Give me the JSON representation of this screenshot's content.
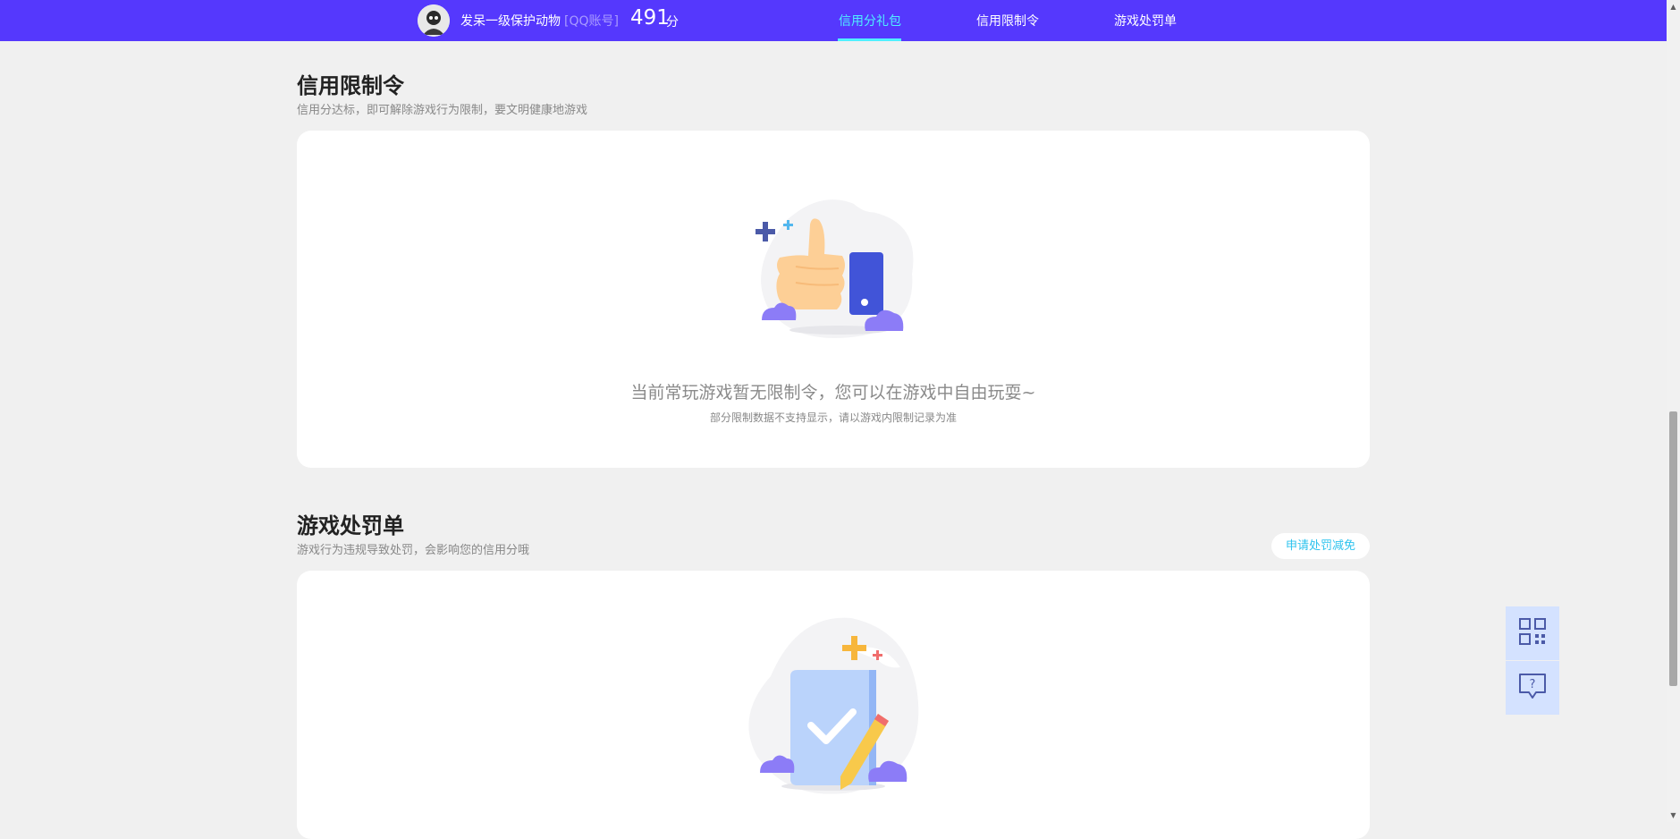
{
  "header": {
    "user_name": "发呆一级保护动物",
    "account_type": "[QQ账号]",
    "score": "491",
    "score_unit": "分",
    "tabs": [
      {
        "label": "信用分礼包",
        "active": true
      },
      {
        "label": "信用限制令",
        "active": false
      },
      {
        "label": "游戏处罚单",
        "active": false
      }
    ]
  },
  "restriction": {
    "title": "信用限制令",
    "subtitle": "信用分达标，即可解除游戏行为限制，要文明健康地游戏",
    "empty_text": "当前常玩游戏暂无限制令，您可以在游戏中自由玩耍~",
    "note": "部分限制数据不支持显示，请以游戏内限制记录为准",
    "illustration_icon": "thumbs-up-icon"
  },
  "penalty": {
    "title": "游戏处罚单",
    "subtitle": "游戏行为违规导致处罚，会影响您的信用分哦",
    "reduce_button": "申请处罚减免",
    "illustration_icon": "document-check-icon"
  },
  "floating": {
    "qr_icon": "qr-code-icon",
    "help_icon": "help-chat-icon"
  },
  "colors": {
    "header_bg": "#5538fd",
    "active_tab": "#4ff0ff",
    "page_bg": "#f0f0f0",
    "link_cyan": "#2ec3ee",
    "float_bg": "#d4e2ff"
  }
}
